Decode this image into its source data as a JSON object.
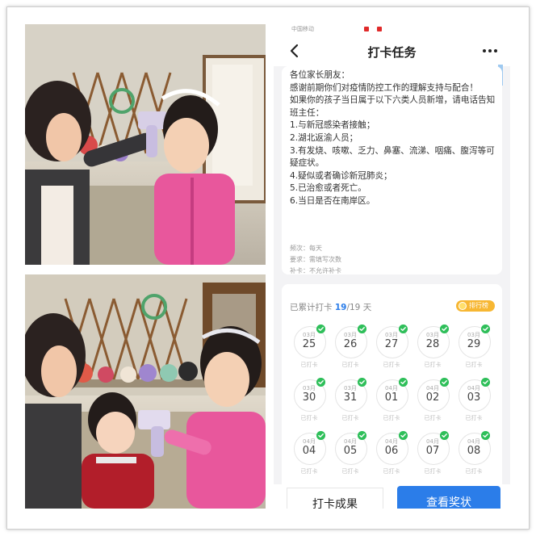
{
  "status_bar": {
    "carrier": "中国移动"
  },
  "header": {
    "title": "打卡任务"
  },
  "notice": {
    "lines": [
      "各位家长朋友：",
      "感谢前期你们对疫情防控工作的理解支持与配合！",
      "如果你的孩子当日属于以下六类人员新增，请电话告知班主任：",
      "1.与新冠感染者接触；",
      "2.湖北返渝人员；",
      "3.有发烧、咳嗽、乏力、鼻塞、流涕、咽痛、腹泻等可疑症状。",
      "4.疑似或者确诊新冠肺炎；",
      "5.已治愈或者死亡。",
      "6.当日是否在南岸区。"
    ],
    "frequency": "频次：每天",
    "requirement": "要求：需填写次数",
    "makeup": "补卡：不允许补卡"
  },
  "stats": {
    "label": "已累计打卡",
    "count": "19",
    "total": "/19 天",
    "rank_label": "排行榜"
  },
  "days": [
    {
      "month": "03月",
      "day": "25",
      "status": "已打卡"
    },
    {
      "month": "03月",
      "day": "26",
      "status": "已打卡"
    },
    {
      "month": "03月",
      "day": "27",
      "status": "已打卡"
    },
    {
      "month": "03月",
      "day": "28",
      "status": "已打卡"
    },
    {
      "month": "03月",
      "day": "29",
      "status": "已打卡"
    },
    {
      "month": "03月",
      "day": "30",
      "status": "已打卡"
    },
    {
      "month": "03月",
      "day": "31",
      "status": "已打卡"
    },
    {
      "month": "04月",
      "day": "01",
      "status": "已打卡"
    },
    {
      "month": "04月",
      "day": "02",
      "status": "已打卡"
    },
    {
      "month": "04月",
      "day": "03",
      "status": "已打卡"
    },
    {
      "month": "04月",
      "day": "04",
      "status": "已打卡"
    },
    {
      "month": "04月",
      "day": "05",
      "status": "已打卡"
    },
    {
      "month": "04月",
      "day": "06",
      "status": "已打卡"
    },
    {
      "month": "04月",
      "day": "07",
      "status": "已打卡"
    },
    {
      "month": "04月",
      "day": "08",
      "status": "已打卡"
    }
  ],
  "buttons": {
    "result": "打卡成果",
    "award": "查看奖状"
  },
  "colors": {
    "accent": "#2b7de9",
    "check": "#2fbf5a",
    "rank": "#f7b733",
    "pink_jacket": "#e8579c"
  },
  "icons": {
    "back": "chevron-left-icon",
    "more": "more-dots-icon",
    "check": "check-circle-icon",
    "rank": "medal-icon"
  }
}
